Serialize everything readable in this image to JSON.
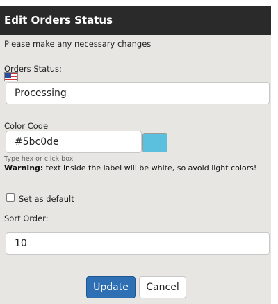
{
  "dialog": {
    "title": "Edit Orders Status",
    "intro": "Please make any necessary changes"
  },
  "orders_status": {
    "label": "Orders Status:",
    "value": "Processing",
    "flag_icon": "us-flag-icon"
  },
  "color_code": {
    "label": "Color Code",
    "value": "#5bc0de",
    "swatch_color": "#5bc0de",
    "hint": "Type hex or click box",
    "warning_strong": "Warning:",
    "warning_text": " text inside the label will be white, so avoid light colors!"
  },
  "default": {
    "label": "Set as default",
    "checked": false
  },
  "sort_order": {
    "label": "Sort Order:",
    "value": "10"
  },
  "buttons": {
    "update": "Update",
    "cancel": "Cancel"
  }
}
